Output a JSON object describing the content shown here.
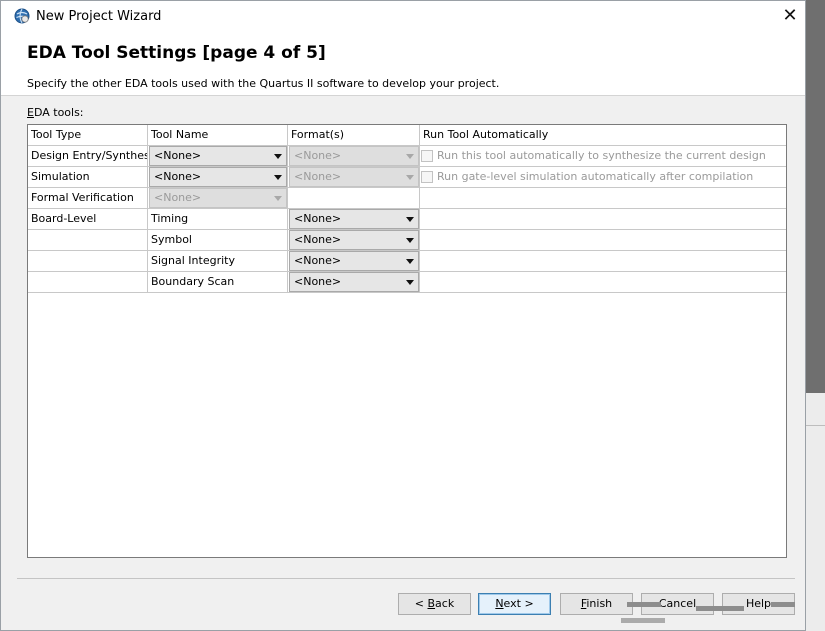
{
  "window": {
    "title": "New Project Wizard"
  },
  "header": {
    "title": "EDA Tool Settings [page 4 of 5]",
    "description": "Specify the other EDA tools used with the Quartus II software to develop your project."
  },
  "eda_tools_label": {
    "accel": "E",
    "rest": "DA tools:"
  },
  "table": {
    "columns": [
      "Tool Type",
      "Tool Name",
      "Format(s)",
      "Run Tool Automatically"
    ],
    "rows": [
      {
        "type": "Design Entry/Synthesis",
        "tool_name": "<None>",
        "format": "<None>",
        "run_auto": "Run this tool automatically to synthesize the current design"
      },
      {
        "type": "Simulation",
        "tool_name": "<None>",
        "format": "<None>",
        "run_auto": "Run gate-level simulation automatically after compilation"
      },
      {
        "type": "Formal Verification",
        "tool_name": "<None>"
      },
      {
        "type": "Board-Level",
        "tool_name": "Timing",
        "format": "<None>"
      },
      {
        "type": "",
        "tool_name": "Symbol",
        "format": "<None>"
      },
      {
        "type": "",
        "tool_name": "Signal Integrity",
        "format": "<None>"
      },
      {
        "type": "",
        "tool_name": "Boundary Scan",
        "format": "<None>"
      }
    ]
  },
  "buttons": {
    "back": {
      "prefix": "< ",
      "accel": "B",
      "rest": "ack"
    },
    "next": {
      "accel": "N",
      "rest": "ext >"
    },
    "finish": {
      "accel": "F",
      "rest": "inish"
    },
    "cancel": {
      "label": "Cancel"
    },
    "help": {
      "label": "Help"
    }
  },
  "icons": {
    "app": "quartus-globe-icon",
    "close": "close-icon",
    "dropdown": "dropdown-arrow-icon"
  },
  "colors": {
    "accent": "#3c7fb1",
    "disabled_text": "#9a9a9a"
  }
}
